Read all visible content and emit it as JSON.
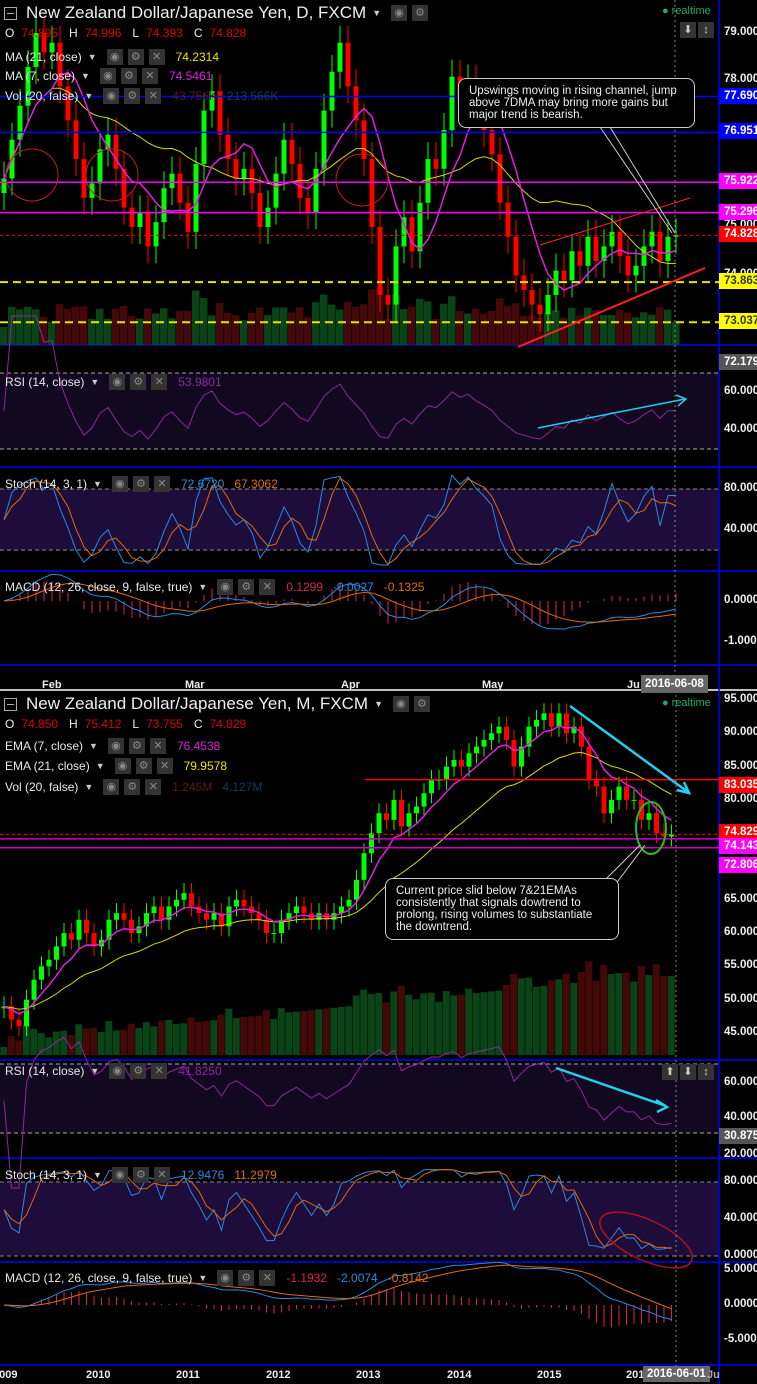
{
  "daily": {
    "title": "New Zealand Dollar/Japanese Yen, D, FXCM",
    "ohlc": {
      "o_label": "O",
      "o": "74.895",
      "h_label": "H",
      "h": "74.996",
      "l_label": "L",
      "l": "74.393",
      "c_label": "C",
      "c": "74.828"
    },
    "indicators": [
      {
        "label": "MA (21, close)",
        "values": [
          "74.2314"
        ],
        "colors": [
          "#e6e600"
        ]
      },
      {
        "label": "MA (7, close)",
        "values": [
          "74.5461"
        ],
        "colors": [
          "#e020e0"
        ]
      },
      {
        "label": "Vol (20, false)",
        "values": [
          "43.756K",
          "213.566K"
        ],
        "colors": [
          "#5a1a1a",
          "#1a3a5a"
        ]
      },
      {
        "label": "RSI (14, close)",
        "values": [
          "53.9801"
        ],
        "colors": [
          "#8a2a9a"
        ]
      },
      {
        "label": "Stoch (14, 3, 1)",
        "values": [
          "72.6720",
          "67.3062"
        ],
        "colors": [
          "#2a8ae0",
          "#e06a10"
        ]
      },
      {
        "label": "MACD (12, 26, close, 9, false, true)",
        "values": [
          "0.1299",
          "-0.0027",
          "-0.1325"
        ],
        "colors": [
          "#e0205a",
          "#2a8ae0",
          "#e06a10"
        ]
      }
    ],
    "realtime": "realtime",
    "price_axis": [
      "79.000",
      "78.000",
      "75.000",
      "74.000"
    ],
    "price_tags": [
      {
        "text": "77.690",
        "bg": "#0000ff",
        "fg": "#fff",
        "price": 77.69
      },
      {
        "text": "76.951",
        "bg": "#0000ff",
        "fg": "#fff",
        "price": 76.951
      },
      {
        "text": "75.922",
        "bg": "#ff00ff",
        "fg": "#fff",
        "price": 75.922
      },
      {
        "text": "75.296",
        "bg": "#ff00ff",
        "fg": "#fff",
        "price": 75.296
      },
      {
        "text": "74.828",
        "bg": "#ff0000",
        "fg": "#fff",
        "price": 74.828
      },
      {
        "text": "73.863",
        "bg": "#ffff00",
        "fg": "#333",
        "price": 73.863
      },
      {
        "text": "73.037",
        "bg": "#ffff00",
        "fg": "#333",
        "price": 73.037
      },
      {
        "text": "72.179",
        "bg": "#555",
        "fg": "#fff",
        "price": 72.179
      }
    ],
    "rsi_axis": [
      "60.0000",
      "40.0000"
    ],
    "stoch_axis": [
      "80.0000",
      "40.0000"
    ],
    "macd_axis": [
      "0.0000",
      "-1.0000"
    ],
    "time_labels": [
      "Feb",
      "Mar",
      "Apr",
      "May",
      "Ju"
    ],
    "cursor_date": "2016-06-08",
    "annotation": "Upswings moving in rising channel, jump above 7DMA may bring more gains but major trend is bearish."
  },
  "monthly": {
    "title": "New Zealand Dollar/Japanese Yen, M, FXCM",
    "ohlc": {
      "o_label": "O",
      "o": "74.850",
      "h_label": "H",
      "h": "75.412",
      "l_label": "L",
      "l": "73.755",
      "c_label": "C",
      "c": "74.829"
    },
    "indicators": [
      {
        "label": "EMA (7, close)",
        "values": [
          "76.4538"
        ],
        "colors": [
          "#e020e0"
        ]
      },
      {
        "label": "EMA (21, close)",
        "values": [
          "79.9578"
        ],
        "colors": [
          "#e6e600"
        ]
      },
      {
        "label": "Vol (20, false)",
        "values": [
          "1.245M",
          "4.127M"
        ],
        "colors": [
          "#5a1a1a",
          "#1a3a5a"
        ]
      },
      {
        "label": "RSI (14, close)",
        "values": [
          "41.8250"
        ],
        "colors": [
          "#8a2a9a"
        ]
      },
      {
        "label": "Stoch (14, 3, 1)",
        "values": [
          "12.9476",
          "11.2979"
        ],
        "colors": [
          "#2a8ae0",
          "#e06a10"
        ]
      },
      {
        "label": "MACD (12, 26, close, 9, false, true)",
        "values": [
          "-1.1932",
          "-2.0074",
          "-0.8142"
        ],
        "colors": [
          "#e0205a",
          "#2a8ae0",
          "#e06a10"
        ]
      }
    ],
    "realtime": "realtime",
    "price_axis": [
      "95.000",
      "90.000",
      "85.000",
      "80.000",
      "70.000",
      "65.000",
      "60.000",
      "55.000",
      "50.000",
      "45.000"
    ],
    "price_tags": [
      {
        "text": "83.035",
        "bg": "#ff0000",
        "fg": "#fff",
        "price": 83.035
      },
      {
        "text": "74.829",
        "bg": "#ff0000",
        "fg": "#fff",
        "price": 74.829
      },
      {
        "text": "74.143",
        "bg": "#ff00ff",
        "fg": "#fff",
        "price": 74.143
      },
      {
        "text": "72.806",
        "bg": "#ff00ff",
        "fg": "#fff",
        "price": 72.806
      }
    ],
    "rsi_axis": [
      "60.0000",
      "40.0000",
      "20.0000"
    ],
    "rsi_tag": "30.8759",
    "stoch_axis": [
      "80.0000",
      "40.0000",
      "0.0000"
    ],
    "macd_axis": [
      "5.0000",
      "0.0000",
      "-5.0000"
    ],
    "time_labels": [
      "2009",
      "2010",
      "2011",
      "2012",
      "2013",
      "2014",
      "2015",
      "201"
    ],
    "cursor_date": "2016-06-01",
    "time_tail": "Ju",
    "annotation": "Current price slid below 7&21EMAs consistently that signals dowtrend to prolong, rising volumes to substantiate the downtrend."
  },
  "chart_data": [
    {
      "type": "candlestick",
      "title": "New Zealand Dollar/Japanese Yen, D, FXCM",
      "x_range": [
        "2016-01",
        "2016-06-08"
      ],
      "ylim": [
        72.179,
        79.6
      ],
      "closes": [
        76.0,
        76.8,
        77.5,
        78.3,
        79.0,
        78.6,
        78.8,
        77.9,
        77.2,
        76.4,
        75.6,
        75.9,
        76.6,
        76.9,
        76.2,
        75.4,
        75.0,
        75.3,
        74.6,
        75.1,
        75.8,
        76.1,
        75.5,
        74.9,
        76.3,
        77.4,
        77.8,
        76.9,
        76.4,
        76.0,
        76.2,
        75.7,
        75.0,
        75.4,
        76.1,
        76.8,
        76.3,
        75.6,
        75.3,
        76.2,
        77.4,
        78.2,
        78.8,
        77.9,
        77.2,
        76.4,
        75.0,
        73.6,
        73.4,
        74.6,
        75.2,
        74.5,
        75.5,
        76.4,
        76.2,
        77.0,
        78.1,
        77.6,
        78.0,
        77.4,
        77.0,
        76.5,
        75.5,
        74.8,
        74.0,
        73.7,
        73.4,
        73.2,
        73.6,
        74.1,
        73.9,
        74.5,
        74.2,
        74.8,
        74.3,
        74.6,
        74.9,
        74.4,
        74.0,
        74.2,
        74.6,
        74.9,
        74.3,
        74.8,
        74.83
      ],
      "colors": {
        "up": "#00ff00",
        "down": "#ff0000"
      }
    },
    {
      "type": "candlestick",
      "title": "New Zealand Dollar/Japanese Yen, M, FXCM",
      "x_range": [
        "2009-01",
        "2016-06"
      ],
      "ylim": [
        43.5,
        96
      ],
      "closes": [
        49,
        47,
        46,
        50,
        53,
        55,
        56,
        58,
        60,
        59,
        62,
        60,
        58,
        59,
        62,
        63,
        62,
        60,
        61,
        63,
        64,
        62,
        64,
        65,
        66,
        64,
        63,
        62,
        63,
        61,
        64,
        65,
        64,
        63,
        62,
        60,
        60,
        62,
        63,
        64,
        63,
        62,
        63,
        62,
        63,
        64,
        65,
        68,
        72,
        75,
        78,
        77,
        80,
        76,
        78,
        79,
        81,
        83,
        83,
        85,
        86,
        85,
        87,
        88,
        89,
        90,
        91,
        89,
        85,
        88,
        91,
        92,
        93,
        91,
        93,
        90,
        91,
        88,
        83,
        82,
        78,
        80,
        82,
        80,
        80,
        77,
        78,
        75,
        74.5,
        74.83
      ],
      "colors": {
        "up": "#00ff00",
        "down": "#ff0000"
      }
    }
  ]
}
